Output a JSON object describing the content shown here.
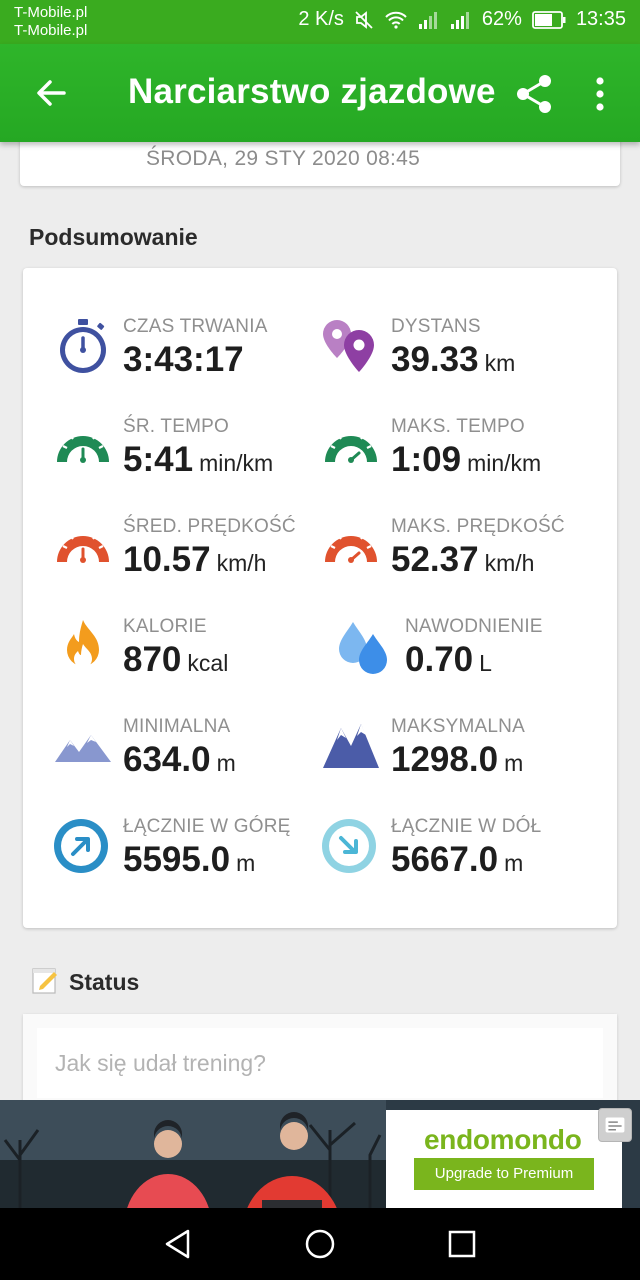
{
  "statusbar": {
    "carrier_1": "T-Mobile.pl",
    "carrier_2": "T-Mobile.pl",
    "speed": "2 K/s",
    "battery": "62%",
    "time": "13:35"
  },
  "appbar": {
    "title": "Narciarstwo zjazdowe"
  },
  "workout": {
    "date": "ŚRODA, 29 STY 2020 08:45"
  },
  "summary": {
    "title": "Podsumowanie",
    "stats": [
      {
        "label": "CZAS TRWANIA",
        "value": "3:43:17",
        "unit": "",
        "icon": "stopwatch-icon"
      },
      {
        "label": "DYSTANS",
        "value": "39.33",
        "unit": "km",
        "icon": "map-pins-icon"
      },
      {
        "label": "ŚR. TEMPO",
        "value": "5:41",
        "unit": "min/km",
        "icon": "speedometer-icon"
      },
      {
        "label": "MAKS. TEMPO",
        "value": "1:09",
        "unit": "min/km",
        "icon": "speedometer-icon"
      },
      {
        "label": "ŚRED. PRĘDKOŚĆ",
        "value": "10.57",
        "unit": "km/h",
        "icon": "speedometer-icon"
      },
      {
        "label": "MAKS. PRĘDKOŚĆ",
        "value": "52.37",
        "unit": "km/h",
        "icon": "speedometer-icon"
      },
      {
        "label": "KALORIE",
        "value": "870",
        "unit": "kcal",
        "icon": "flame-icon"
      },
      {
        "label": "NAWODNIENIE",
        "value": "0.70",
        "unit": "L",
        "icon": "water-drops-icon"
      },
      {
        "label": "MINIMALNA",
        "value": "634.0",
        "unit": "m",
        "icon": "mountain-low-icon"
      },
      {
        "label": "MAKSYMALNA",
        "value": "1298.0",
        "unit": "m",
        "icon": "mountain-high-icon"
      },
      {
        "label": "ŁĄCZNIE W GÓRĘ",
        "value": "5595.0",
        "unit": "m",
        "icon": "arrow-up-circle-icon"
      },
      {
        "label": "ŁĄCZNIE W DÓŁ",
        "value": "5667.0",
        "unit": "m",
        "icon": "arrow-down-circle-icon"
      }
    ]
  },
  "status": {
    "title": "Status",
    "placeholder": "Jak się udał trening?"
  },
  "ad": {
    "brand": "endomondo",
    "cta": "Upgrade to Premium"
  },
  "colors": {
    "appbar_green": "#2fb52a",
    "stopwatch_blue": "#3f51a0",
    "pin_purple": "#8e3fa3",
    "pace_green": "#1f8a55",
    "speed_red": "#e0522e",
    "flame_orange": "#f39c1d",
    "drop_blue": "#3d8ee8",
    "mountain_blue": "#4b5ca8",
    "up_blue": "#2a8ec6",
    "down_light_blue": "#8fd3e3",
    "ad_green": "#7ab51d"
  }
}
